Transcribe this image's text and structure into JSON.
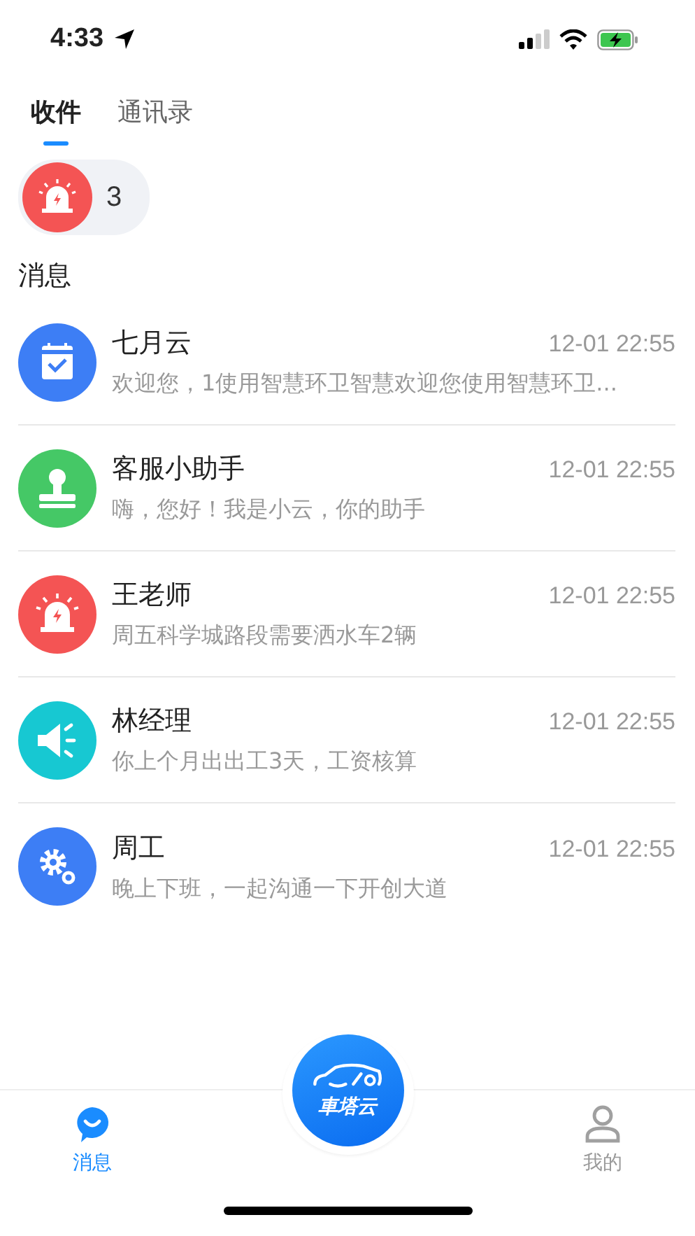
{
  "status_bar": {
    "time": "4:33"
  },
  "tabs": [
    {
      "label": "收件",
      "selected": true
    },
    {
      "label": "通讯录",
      "selected": false
    }
  ],
  "alert_badge": {
    "count": "3"
  },
  "section_title": "消息",
  "messages": [
    {
      "kind": "calendar",
      "color": "#3d7ef5",
      "name": "七月云",
      "time": "12-01 22:55",
      "preview": "欢迎您，1使用智慧环卫智慧欢迎您使用智慧环卫..."
    },
    {
      "kind": "stamp",
      "color": "#45c866",
      "name": "客服小助手",
      "time": "12-01 22:55",
      "preview": "嗨，您好！我是小云，你的助手"
    },
    {
      "kind": "alarm",
      "color": "#f45454",
      "name": "王老师",
      "time": "12-01 22:55",
      "preview": "周五科学城路段需要洒水车2辆"
    },
    {
      "kind": "speaker",
      "color": "#17c8d2",
      "name": "林经理",
      "time": "12-01 22:55",
      "preview": "你上个月出出工3天，工资核算"
    },
    {
      "kind": "gears",
      "color": "#3d7ef5",
      "name": "周工",
      "time": "12-01 22:55",
      "preview": "晚上下班，一起沟通一下开创大道"
    }
  ],
  "bottom_nav": {
    "items": [
      {
        "kind": "chat",
        "label": "消息",
        "selected": true
      },
      {
        "kind": "profile",
        "label": "我的",
        "selected": false
      }
    ],
    "center_logo": {
      "text": "車塔云"
    }
  }
}
